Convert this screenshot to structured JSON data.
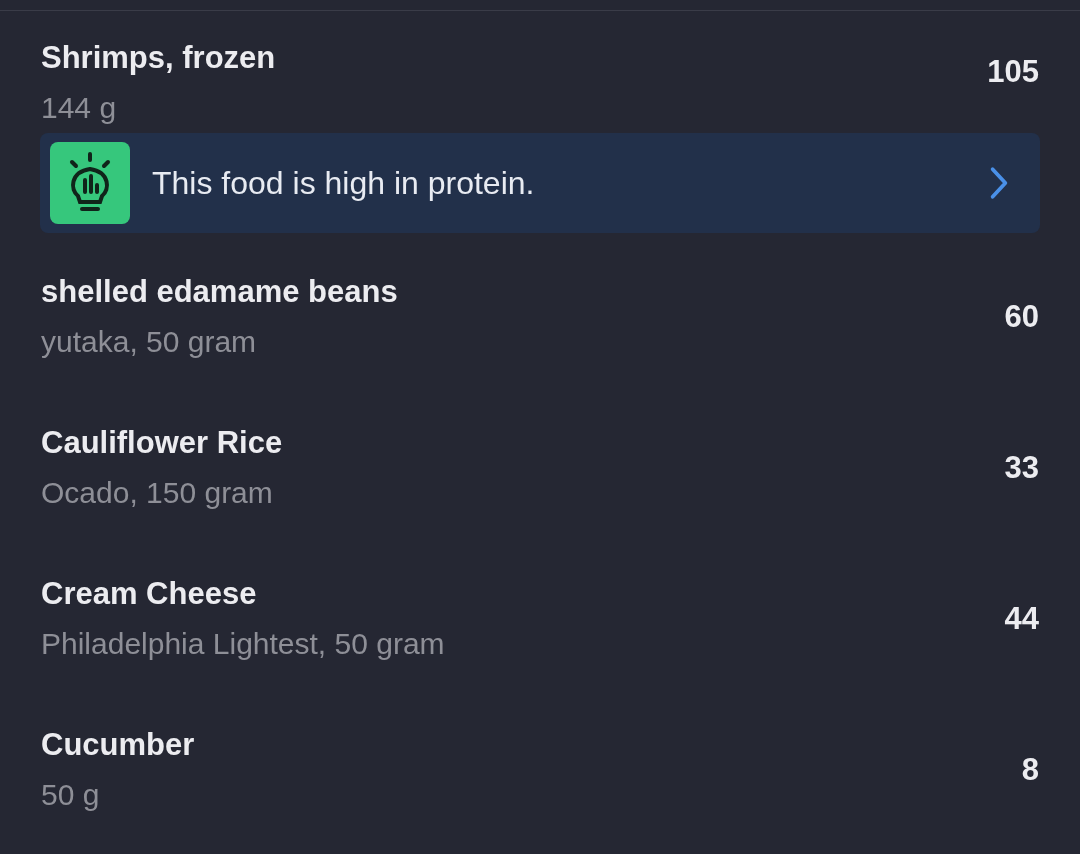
{
  "entries": [
    {
      "name": "Shrimps, frozen",
      "detail": "144 g",
      "calories": "105",
      "tip": {
        "text": "This food is high in protein."
      }
    },
    {
      "name": "shelled edamame beans",
      "detail": "yutaka, 50 gram",
      "calories": "60"
    },
    {
      "name": "Cauliflower Rice",
      "detail": "Ocado, 150 gram",
      "calories": "33"
    },
    {
      "name": "Cream Cheese",
      "detail": "Philadelphia Lightest, 50 gram",
      "calories": "44"
    },
    {
      "name": "Cucumber",
      "detail": "50 g",
      "calories": "8"
    }
  ]
}
